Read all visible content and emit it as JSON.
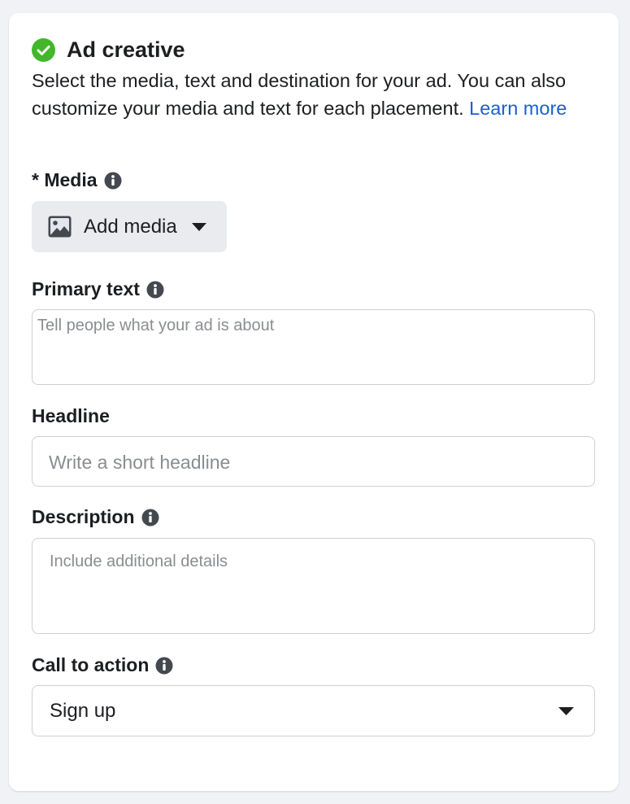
{
  "section": {
    "title": "Ad creative",
    "intro_text": "Select the media, text and destination for your ad. You can also customize your media and text for each placement.",
    "learn_more": "Learn more",
    "status_icon": "check-circle-icon",
    "status_color": "#42b72a"
  },
  "media": {
    "label": "* Media",
    "button_label": "Add media",
    "button_icon": "image-icon"
  },
  "primary_text": {
    "label": "Primary text",
    "placeholder": "Tell people what your ad is about",
    "value": ""
  },
  "headline": {
    "label": "Headline",
    "placeholder": "Write a short headline",
    "value": ""
  },
  "description": {
    "label": "Description",
    "placeholder": "Include additional details",
    "value": ""
  },
  "call_to_action": {
    "label": "Call to action",
    "selected": "Sign up"
  },
  "colors": {
    "link": "#1a5fd1",
    "text": "#1c1e21",
    "placeholder": "#8a8d91",
    "border": "#ccd0d5",
    "button_bg": "#e9ebee"
  }
}
